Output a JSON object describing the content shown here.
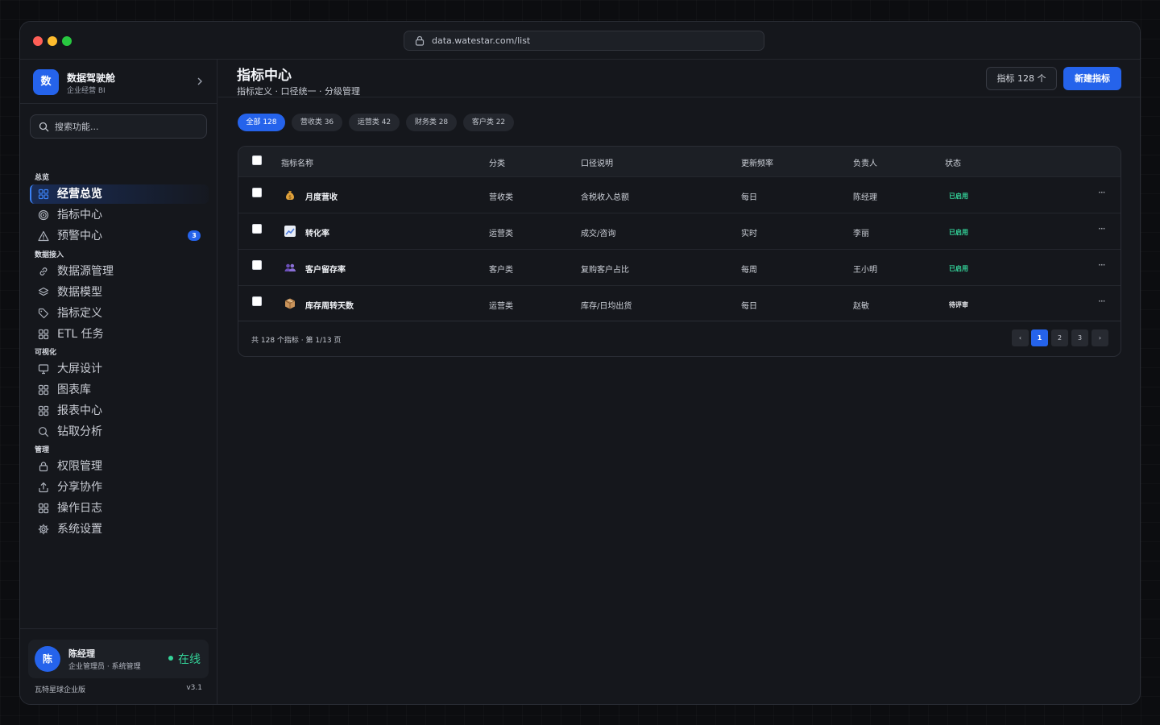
{
  "browser": {
    "url": "data.watestar.com/list"
  },
  "brand": {
    "logo": "数",
    "name": "数据驾驶舱",
    "subtitle": "企业经营 BI"
  },
  "search": {
    "placeholder": "搜索功能..."
  },
  "nav": {
    "sections": [
      {
        "title": "总览",
        "items": [
          {
            "label": "经营总览",
            "icon": "grid-icon",
            "active": true
          },
          {
            "label": "指标中心",
            "icon": "target-icon"
          },
          {
            "label": "预警中心",
            "icon": "alert-icon",
            "badge": "3"
          }
        ]
      },
      {
        "title": "数据接入",
        "items": [
          {
            "label": "数据源管理",
            "icon": "link-icon"
          },
          {
            "label": "数据模型",
            "icon": "layers-icon"
          },
          {
            "label": "指标定义",
            "icon": "tag-icon"
          },
          {
            "label": "ETL 任务",
            "icon": "grid-icon"
          }
        ]
      },
      {
        "title": "可视化",
        "items": [
          {
            "label": "大屏设计",
            "icon": "monitor-icon"
          },
          {
            "label": "图表库",
            "icon": "grid-icon"
          },
          {
            "label": "报表中心",
            "icon": "grid-icon"
          },
          {
            "label": "钻取分析",
            "icon": "search-icon"
          }
        ]
      },
      {
        "title": "管理",
        "items": [
          {
            "label": "权限管理",
            "icon": "lock-icon"
          },
          {
            "label": "分享协作",
            "icon": "share-icon"
          },
          {
            "label": "操作日志",
            "icon": "grid-icon"
          },
          {
            "label": "系统设置",
            "icon": "gear-icon"
          }
        ]
      }
    ]
  },
  "user": {
    "avatar": "陈",
    "name": "陈经理",
    "role": "企业管理员 · 系统管理",
    "status": "在线"
  },
  "footer": {
    "edition": "瓦特星球企业版",
    "version": "v3.1"
  },
  "header": {
    "title": "指标中心",
    "subtitle": "指标定义 · 口径统一 · 分级管理",
    "count_label": "指标 128 个",
    "new_label": "新建指标"
  },
  "filters": [
    {
      "label": "全部 128",
      "active": true
    },
    {
      "label": "营收类 36"
    },
    {
      "label": "运营类 42"
    },
    {
      "label": "财务类 28"
    },
    {
      "label": "客户类 22"
    }
  ],
  "table": {
    "columns": [
      "指标名称",
      "分类",
      "口径说明",
      "更新频率",
      "负责人",
      "状态"
    ],
    "rows": [
      {
        "icon": "money-bag-icon",
        "name": "月度营收",
        "category": "营收类",
        "definition": "含税收入总额",
        "frequency": "每日",
        "owner": "陈经理",
        "status": "已启用",
        "status_type": "on"
      },
      {
        "icon": "chart-up-icon",
        "name": "转化率",
        "category": "运营类",
        "definition": "成交/咨询",
        "frequency": "实时",
        "owner": "李丽",
        "status": "已启用",
        "status_type": "on"
      },
      {
        "icon": "users-icon",
        "name": "客户留存率",
        "category": "客户类",
        "definition": "复购客户占比",
        "frequency": "每周",
        "owner": "王小明",
        "status": "已启用",
        "status_type": "on"
      },
      {
        "icon": "package-icon",
        "name": "库存周转天数",
        "category": "运营类",
        "definition": "库存/日均出货",
        "frequency": "每日",
        "owner": "赵敏",
        "status": "待评审",
        "status_type": "pending"
      }
    ],
    "footer_text": "共 128 个指标 · 第 1/13 页",
    "pages": [
      "‹",
      "1",
      "2",
      "3",
      "›"
    ]
  },
  "colors": {
    "accent": "#2563eb",
    "success": "#34d399",
    "background": "#15171c"
  }
}
